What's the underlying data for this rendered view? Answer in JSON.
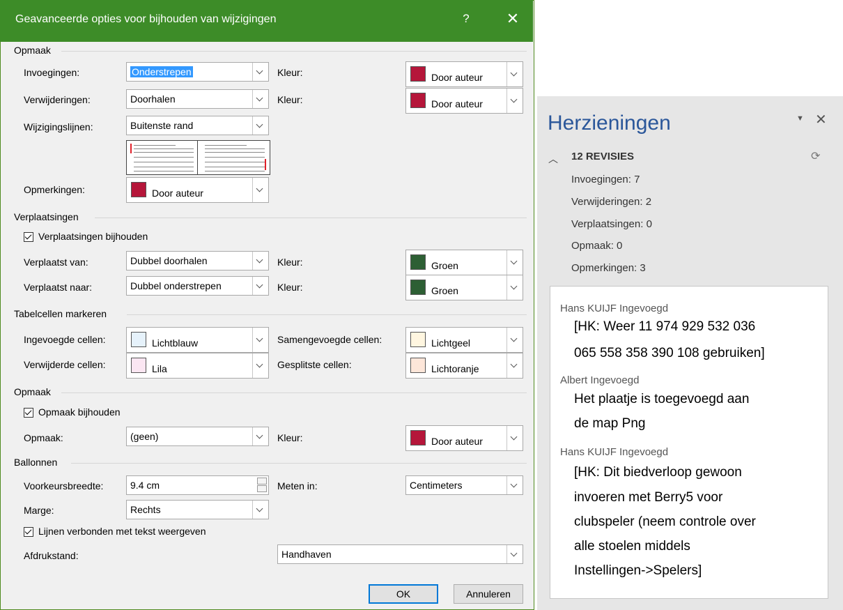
{
  "dialog": {
    "title": "Geavanceerde opties voor bijhouden van wijzigingen",
    "help": "?",
    "close": "✕",
    "sections": {
      "markup1": "Opmaak",
      "moves": "Verplaatsingen",
      "cells": "Tabelcellen markeren",
      "formatting": "Opmaak",
      "balloons": "Ballonnen"
    },
    "markup": {
      "insertions_label": "Invoegingen:",
      "insertions_value": "Onderstrepen",
      "insertions_color_label": "Kleur:",
      "insertions_color": "Door auteur",
      "deletions_label": "Verwijderingen:",
      "deletions_value": "Doorhalen",
      "deletions_color_label": "Kleur:",
      "deletions_color": "Door auteur",
      "changed_lines_label": "Wijzigingslijnen:",
      "changed_lines_value": "Buitenste rand",
      "comments_label": "Opmerkingen:",
      "comments_color": "Door auteur"
    },
    "moves": {
      "track_label": "Verplaatsingen bijhouden",
      "track_checked": true,
      "from_label": "Verplaatst van:",
      "from_value": "Dubbel doorhalen",
      "from_color_label": "Kleur:",
      "from_color": "Groen",
      "to_label": "Verplaatst naar:",
      "to_value": "Dubbel onderstrepen",
      "to_color_label": "Kleur:",
      "to_color": "Groen"
    },
    "cells": {
      "inserted_label": "Ingevoegde cellen:",
      "inserted_value": "Lichtblauw",
      "deleted_label": "Verwijderde cellen:",
      "deleted_value": "Lila",
      "merged_label": "Samengevoegde cellen:",
      "merged_value": "Lichtgeel",
      "split_label": "Gesplitste cellen:",
      "split_value": "Lichtoranje"
    },
    "formatting": {
      "track_label": "Opmaak bijhouden",
      "track_checked": true,
      "format_label": "Opmaak:",
      "format_value": "(geen)",
      "color_label": "Kleur:",
      "color_value": "Door auteur"
    },
    "balloons": {
      "width_label": "Voorkeursbreedte:",
      "width_value": "9.4 cm",
      "measure_label": "Meten in:",
      "measure_value": "Centimeters",
      "margin_label": "Marge:",
      "margin_value": "Rechts",
      "lines_label": "Lijnen verbonden met tekst weergeven",
      "lines_checked": true,
      "print_label": "Afdrukstand:",
      "print_value": "Handhaven"
    },
    "buttons": {
      "ok": "OK",
      "cancel": "Annuleren"
    }
  },
  "colors": {
    "title_bar": "#3d8c28",
    "by_author": "#b5163a",
    "green": "#2d5f34",
    "light_blue": "#e6f2fb",
    "lilac": "#fbe6f2",
    "light_yellow": "#fff6e0",
    "light_orange": "#fde6d9",
    "pane_title": "#2b579a",
    "change_bar": "#e0202a"
  },
  "pane": {
    "title": "Herzieningen",
    "menu_icon": "▼",
    "close_icon": "✕",
    "count_label": "12 REVISIES",
    "stats": [
      "Invoegingen: 7",
      "Verwijderingen: 2",
      "Verplaatsingen: 0",
      "Opmaak: 0",
      "Opmerkingen: 3"
    ],
    "comments": [
      {
        "author": "Hans KUIJF Ingevoegd",
        "lines": [
          "[HK: Weer 11 974 929 532 036",
          "065 558 358 390 108 gebruiken]"
        ]
      },
      {
        "author": "Albert Ingevoegd",
        "lines": [
          "Het plaatje is toegevoegd aan",
          "de map Png"
        ]
      },
      {
        "author": "Hans KUIJF Ingevoegd",
        "lines": [
          "[HK: Dit biedverloop gewoon",
          "invoeren met Berry5 voor",
          "clubspeler (neem controle over",
          "alle stoelen middels",
          "Instellingen->Spelers]"
        ]
      }
    ]
  }
}
